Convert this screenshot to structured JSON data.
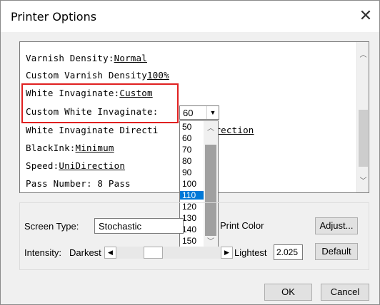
{
  "window": {
    "title": "Printer Options",
    "close_icon": "close-icon"
  },
  "options_list": {
    "lines": [
      {
        "label": "Varnish Density:",
        "value": "Normal"
      },
      {
        "label": "Custom Varnish Density",
        "value": "100%"
      },
      {
        "label": "White Invaginate:",
        "value": "Custom"
      },
      {
        "label": "Custom White Invaginate:",
        "value": ""
      },
      {
        "label": "White Invaginate Directi",
        "value": "Direction"
      },
      {
        "label": "BlackInk:",
        "value": "Minimum"
      },
      {
        "label": "Speed:",
        "value": "UniDirection"
      },
      {
        "label": "Pass Number: 8 Pass",
        "value": ""
      }
    ],
    "highlight_color": "#e02020"
  },
  "white_invaginate_combo": {
    "selected": "60",
    "options": [
      "50",
      "60",
      "70",
      "80",
      "90",
      "100",
      "110",
      "120",
      "130",
      "140",
      "150"
    ],
    "highlighted": "110",
    "highlight_color": "#0078d7"
  },
  "settings": {
    "screen_type_label": "Screen Type:",
    "screen_type_value": "Stochastic",
    "print_color_label": "Print Color",
    "adjust_label": "Adjust...",
    "intensity_label": "Intensity:",
    "darkest_label": "Darkest",
    "lightest_label": "Lightest",
    "intensity_value": "2.025",
    "default_label": "Default"
  },
  "footer": {
    "ok_label": "OK",
    "cancel_label": "Cancel"
  }
}
